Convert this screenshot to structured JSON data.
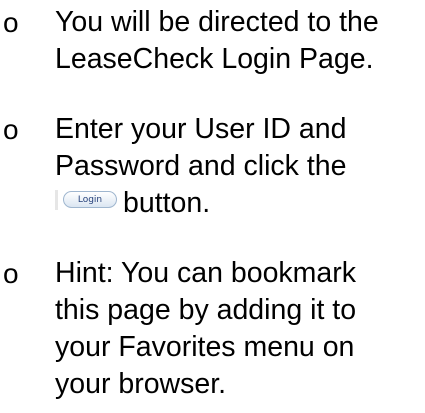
{
  "bullet_symbol": "o",
  "items": [
    {
      "lines": [
        "You will be directed to the",
        "LeaseCheck Login Page."
      ]
    },
    {
      "lines": [
        "Enter your User ID and",
        "Password and click the"
      ],
      "button_label": "Login",
      "after_button": "button."
    },
    {
      "lines": [
        "Hint: You can bookmark",
        "this page by adding it to",
        "your Favorites menu on",
        "your browser."
      ]
    }
  ]
}
